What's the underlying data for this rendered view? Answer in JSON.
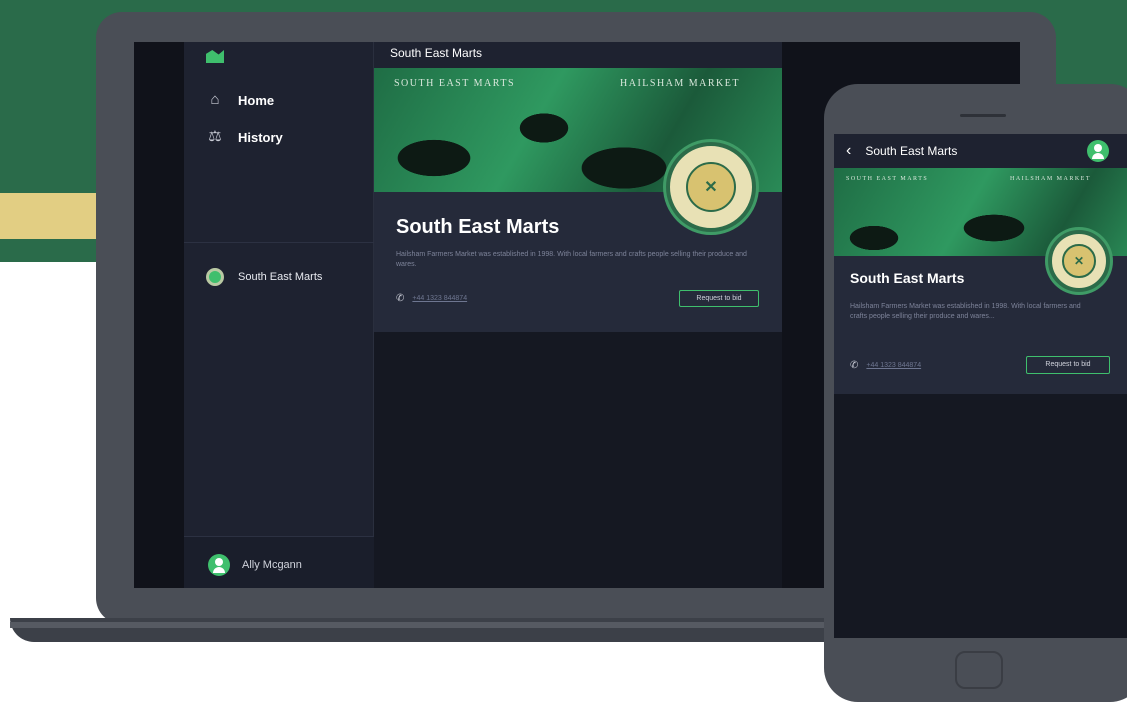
{
  "desktop": {
    "sidebar": {
      "nav": [
        {
          "label": "Home",
          "icon": "home-icon"
        },
        {
          "label": "History",
          "icon": "history-icon"
        }
      ],
      "market_item": "South East  Marts",
      "user_name": "Ally Mcgann"
    },
    "header_title": "South East Marts",
    "card": {
      "banner_left_text": "SOUTH EAST MARTS",
      "banner_right_text": "HAILSHAM MARKET",
      "title": "South East  Marts",
      "description": "Hailsham Farmers Market was established in 1998. With local farmers and crafts people selling their produce and wares.",
      "phone": "+44 1323 844874",
      "request_button": "Request to bid"
    }
  },
  "mobile": {
    "header_title": "South East  Marts",
    "card": {
      "banner_left_text": "SOUTH EAST MARTS",
      "banner_right_text": "HAILSHAM MARKET",
      "title": "South East  Marts",
      "description": "Hailsham Farmers Market was established in 1998. With local farmers and crafts people selling their produce and wares...",
      "phone": "+44 1323 844874",
      "request_button": "Request to bid"
    }
  },
  "colors": {
    "brand_green": "#3fbf6d",
    "backdrop_green": "#2a6b4a",
    "accent_gold": "#e2ce83",
    "panel_dark": "#1e2230"
  }
}
